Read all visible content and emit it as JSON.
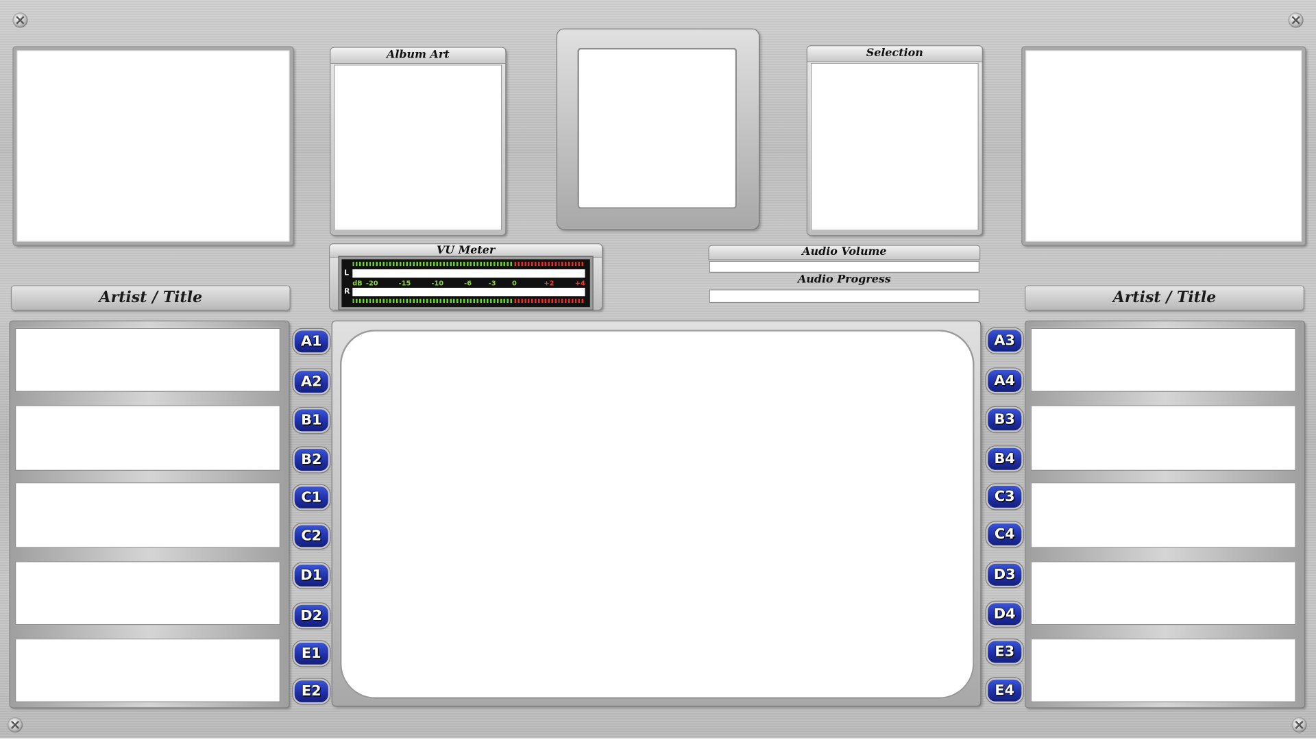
{
  "panels": {
    "album_art": {
      "title": "Album Art"
    },
    "selection": {
      "title": "Selection"
    },
    "vu_meter": {
      "title": "VU Meter",
      "channel_left": "L",
      "channel_right": "R",
      "scale": [
        "dB",
        "-20",
        "-15",
        "-10",
        "-6",
        "-3",
        "0",
        "+2",
        "+4"
      ],
      "colors": {
        "green": "#6ad02e",
        "red": "#e0302a",
        "background": "#111111"
      }
    },
    "audio_volume": {
      "title": "Audio Volume"
    },
    "audio_progress": {
      "title": "Audio Progress"
    }
  },
  "left_column": {
    "header": "Artist / Title",
    "buttons": [
      "A1",
      "A2",
      "B1",
      "B2",
      "C1",
      "C2",
      "D1",
      "D2",
      "E1",
      "E2"
    ]
  },
  "right_column": {
    "header": "Artist / Title",
    "buttons": [
      "A3",
      "A4",
      "B3",
      "B4",
      "C3",
      "C4",
      "D3",
      "D4",
      "E3",
      "E4"
    ]
  },
  "colors": {
    "button": "#1f2fa8",
    "panel": "#c4c4c4"
  }
}
